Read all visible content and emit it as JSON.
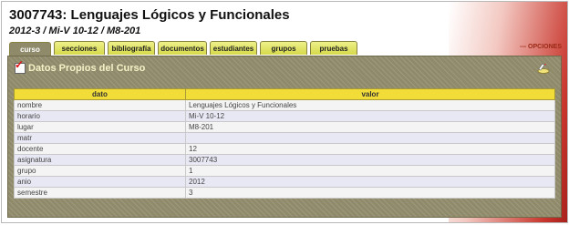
{
  "page": {
    "title": "3007743: Lenguajes Lógicos y Funcionales",
    "subtitle": "2012-3 / Mi-V 10-12 / M8-201"
  },
  "tabs": [
    {
      "label": "curso",
      "active": true
    },
    {
      "label": "secciones",
      "active": false
    },
    {
      "label": "bibliografía",
      "active": false
    },
    {
      "label": "documentos",
      "active": false
    },
    {
      "label": "estudiantes",
      "active": false
    },
    {
      "label": "grupos",
      "active": false
    },
    {
      "label": "pruebas",
      "active": false
    }
  ],
  "options_label": "--- OPCIONES",
  "panel": {
    "title": "Datos Propios del Curso",
    "icons": {
      "checkbox": "checkmark-icon",
      "edit": "edit-icon"
    }
  },
  "table": {
    "headers": [
      "dato",
      "valor"
    ],
    "rows": [
      {
        "dato": "nombre",
        "valor": "Lenguajes Lógicos y Funcionales"
      },
      {
        "dato": "horario",
        "valor": "Mi-V 10-12"
      },
      {
        "dato": "lugar",
        "valor": "M8-201"
      },
      {
        "dato": "matr",
        "valor": ""
      },
      {
        "dato": "docente",
        "valor": "12"
      },
      {
        "dato": "asignatura",
        "valor": "3007743"
      },
      {
        "dato": "grupo",
        "valor": "1"
      },
      {
        "dato": "anio",
        "valor": "2012"
      },
      {
        "dato": "semestre",
        "valor": "3"
      }
    ]
  },
  "colors": {
    "panel_bg": "#8f8a6a",
    "tab_bg": "#e3e66a",
    "header_bg": "#f2dc38",
    "accent_red": "#c8352c"
  }
}
